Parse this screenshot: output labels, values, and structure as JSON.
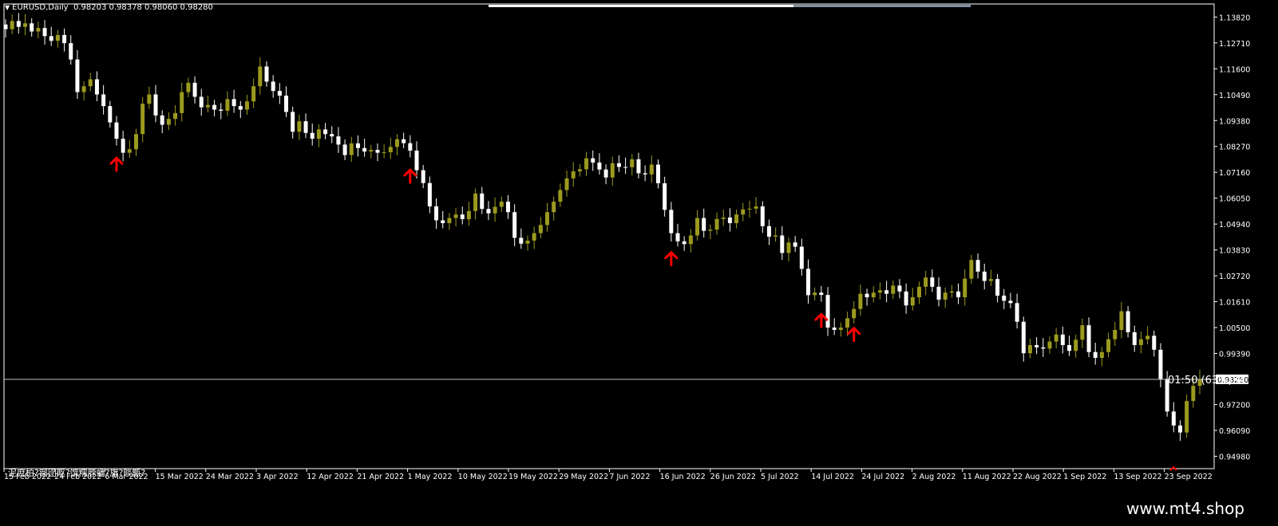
{
  "header": {
    "symbol_timeframe": "EURUSD,Daily",
    "ohlc": "0.98203 0.98378 0.98060 0.98280"
  },
  "overlay_texts": {
    "countdown": "01:50 (63%) M",
    "garbled_comment": "泥庶柏?镏囹眍?馔糯脖蟠?旗?赕甑?",
    "watermark": "www.mt4.shop"
  },
  "colors": {
    "background": "#000000",
    "bull_candle": "#9c9a1e",
    "bear_candle": "#ffffff",
    "wick": "#ffffff",
    "arrow": "#ff0000",
    "price_line": "#c0c0c0",
    "axis": "#ffffff"
  },
  "chart_data": {
    "type": "candlestick",
    "symbol": "EURUSD",
    "timeframe": "Daily",
    "ylim": [
      0.9445,
      1.1438
    ],
    "y_ticks": [
      "1.13820",
      "1.12710",
      "1.11600",
      "1.10490",
      "1.09380",
      "1.08270",
      "1.07160",
      "1.06050",
      "1.04940",
      "1.03830",
      "1.02720",
      "1.01610",
      "1.00500",
      "0.99390",
      "0.98280",
      "0.97200",
      "0.96090",
      "0.94980"
    ],
    "x_ticks": [
      "15 Feb 2022",
      "24 Feb 2022",
      "6 Mar 2022",
      "15 Mar 2022",
      "24 Mar 2022",
      "3 Apr 2022",
      "12 Apr 2022",
      "21 Apr 2022",
      "1 May 2022",
      "10 May 2022",
      "19 May 2022",
      "29 May 2022",
      "7 Jun 2022",
      "16 Jun 2022",
      "26 Jun 2022",
      "5 Jul 2022",
      "14 Jul 2022",
      "24 Jul 2022",
      "2 Aug 2022",
      "11 Aug 2022",
      "22 Aug 2022",
      "1 Sep 2022",
      "13 Sep 2022",
      "23 Sep 2022"
    ],
    "current_price": "0.98280",
    "closes": [
      1.133,
      1.1365,
      1.134,
      1.1355,
      1.132,
      1.1335,
      1.13,
      1.128,
      1.1305,
      1.127,
      1.12,
      1.106,
      1.1085,
      1.1115,
      1.105,
      1.1,
      1.093,
      1.086,
      1.08,
      1.0815,
      1.088,
      1.101,
      1.105,
      1.096,
      1.092,
      1.0945,
      1.097,
      1.106,
      1.11,
      1.104,
      1.0995,
      1.1005,
      1.0985,
      1.098,
      1.103,
      1.1,
      1.0985,
      1.102,
      1.1085,
      1.117,
      1.1105,
      1.1065,
      1.1045,
      1.0975,
      1.089,
      1.0935,
      1.0885,
      1.086,
      1.09,
      1.088,
      1.087,
      1.0835,
      1.079,
      1.084,
      1.082,
      1.0805,
      1.0812,
      1.08,
      1.0802,
      1.0825,
      1.0858,
      1.0841,
      1.0809,
      1.0725,
      1.067,
      1.057,
      1.051,
      1.0498,
      1.052,
      1.0535,
      1.0515,
      1.055,
      1.0625,
      1.0559,
      1.054,
      1.0568,
      1.059,
      1.0545,
      1.0435,
      1.041,
      1.0423,
      1.0455,
      1.049,
      1.0545,
      1.059,
      1.064,
      1.069,
      1.072,
      1.0729,
      1.0776,
      1.0758,
      1.0728,
      1.0694,
      1.0755,
      1.0739,
      1.0738,
      1.0772,
      1.0712,
      1.0707,
      1.0749,
      1.0669,
      1.0555,
      1.0455,
      1.042,
      1.0408,
      1.0445,
      1.052,
      1.0465,
      1.047,
      1.0516,
      1.0522,
      1.0498,
      1.0535,
      1.0557,
      1.056,
      1.057,
      1.0485,
      1.044,
      1.0445,
      1.037,
      1.0415,
      1.0397,
      1.0302,
      1.0189,
      1.02,
      1.019,
      1.005,
      1.004,
      1.005,
      1.009,
      1.013,
      1.0195,
      1.018,
      1.02,
      1.021,
      1.0195,
      1.023,
      1.0205,
      1.0145,
      1.018,
      1.0225,
      1.0265,
      1.0225,
      1.017,
      1.02,
      1.0205,
      1.018,
      1.026,
      1.034,
      1.029,
      1.025,
      1.0258,
      1.0187,
      1.0165,
      1.0155,
      1.0075,
      0.994,
      0.9975,
      0.9965,
      0.996,
      0.999,
      1.002,
      0.9975,
      0.995,
      0.9998,
      1.006,
      0.9945,
      0.992,
      0.9945,
      1.0,
      1.004,
      1.012,
      1.003,
      0.9975,
      1.0,
      1.0015,
      0.9955,
      0.983,
      0.969,
      0.963,
      0.96,
      0.9735,
      0.98,
      0.9828
    ],
    "signal_arrows_under_index": [
      17,
      62,
      102,
      125,
      130
    ]
  }
}
